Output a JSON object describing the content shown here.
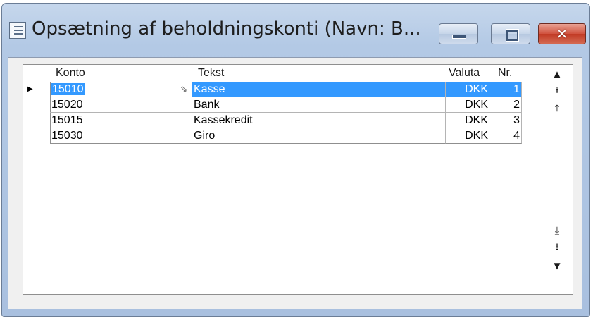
{
  "window": {
    "title": "Opsætning af beholdningskonti (Navn: B...",
    "close_glyph": "✕"
  },
  "grid": {
    "columns": {
      "konto": "Konto",
      "tekst": "Tekst",
      "valuta": "Valuta",
      "nr": "Nr."
    },
    "current_row_indicator": "▶",
    "lookup_glyph": "⇘",
    "rows": [
      {
        "konto": "15010",
        "tekst": "Kasse",
        "valuta": "DKK",
        "nr": "1"
      },
      {
        "konto": "15020",
        "tekst": "Bank",
        "valuta": "DKK",
        "nr": "2"
      },
      {
        "konto": "15015",
        "tekst": "Kassekredit",
        "valuta": "DKK",
        "nr": "3"
      },
      {
        "konto": "15030",
        "tekst": "Giro",
        "valuta": "DKK",
        "nr": "4"
      }
    ],
    "selected_row": 0
  },
  "navigation": {
    "scroll_up": "▲",
    "prev_record": "⭱",
    "first_record": "⤒",
    "last_record": "⤓",
    "next_record": "⭳",
    "scroll_down": "▼"
  }
}
